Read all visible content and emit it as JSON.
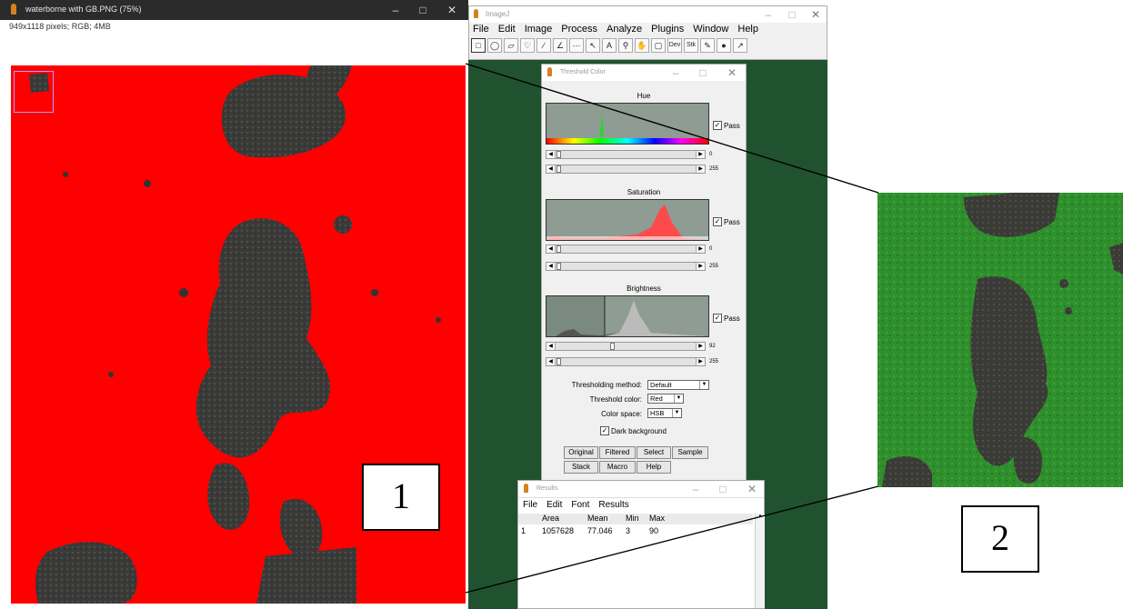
{
  "image_window": {
    "title": "waterborne with GB.PNG (75%)",
    "info": "949x1118 pixels; RGB; 4MB",
    "label": "1"
  },
  "imagej": {
    "title": "ImageJ",
    "menus": [
      "File",
      "Edit",
      "Image",
      "Process",
      "Analyze",
      "Plugins",
      "Window",
      "Help"
    ],
    "tools": [
      "rectangle-tool",
      "oval-tool",
      "polygon-tool",
      "freehand-tool",
      "line-tool",
      "angle-tool",
      "point-tool",
      "wand-tool",
      "text-tool",
      "magnifier-tool",
      "hand-tool",
      "color-picker-tool",
      "dev-tool",
      "stk-tool",
      "pencil-tool",
      "dropper-tool",
      "arrow-tool"
    ],
    "tool_labels": {
      "text": "A",
      "dev": "Dev",
      "stk": "Stk"
    }
  },
  "threshold_color": {
    "title": "Threshold Color",
    "hue": {
      "label": "Hue",
      "pass": "Pass",
      "min": "0",
      "max": "255"
    },
    "saturation": {
      "label": "Saturation",
      "pass": "Pass",
      "min": "0",
      "max": "255"
    },
    "brightness": {
      "label": "Brightness",
      "pass": "Pass",
      "min": "92",
      "max": "255"
    },
    "method_label": "Thresholding method:",
    "method_value": "Default",
    "color_label": "Threshold color:",
    "color_value": "Red",
    "space_label": "Color space:",
    "space_value": "HSB",
    "dark_bg_label": "Dark background",
    "buttons": {
      "original": "Original",
      "filtered": "Filtered",
      "select": "Select",
      "sample": "Sample",
      "stack": "Stack",
      "macro": "Macro",
      "help": "Help"
    }
  },
  "results": {
    "title": "Results",
    "menus": [
      "File",
      "Edit",
      "Font",
      "Results"
    ],
    "columns": [
      "Area",
      "Mean",
      "Min",
      "Max"
    ],
    "rows": [
      {
        "index": "1",
        "area": "1057628",
        "mean": "77.046",
        "min": "3",
        "max": "90"
      }
    ]
  },
  "zoom_label": "2",
  "colors": {
    "threshold_red": "#ff0000",
    "backdrop_green": "#20522f",
    "zoom_green": "#2f8f2c"
  }
}
